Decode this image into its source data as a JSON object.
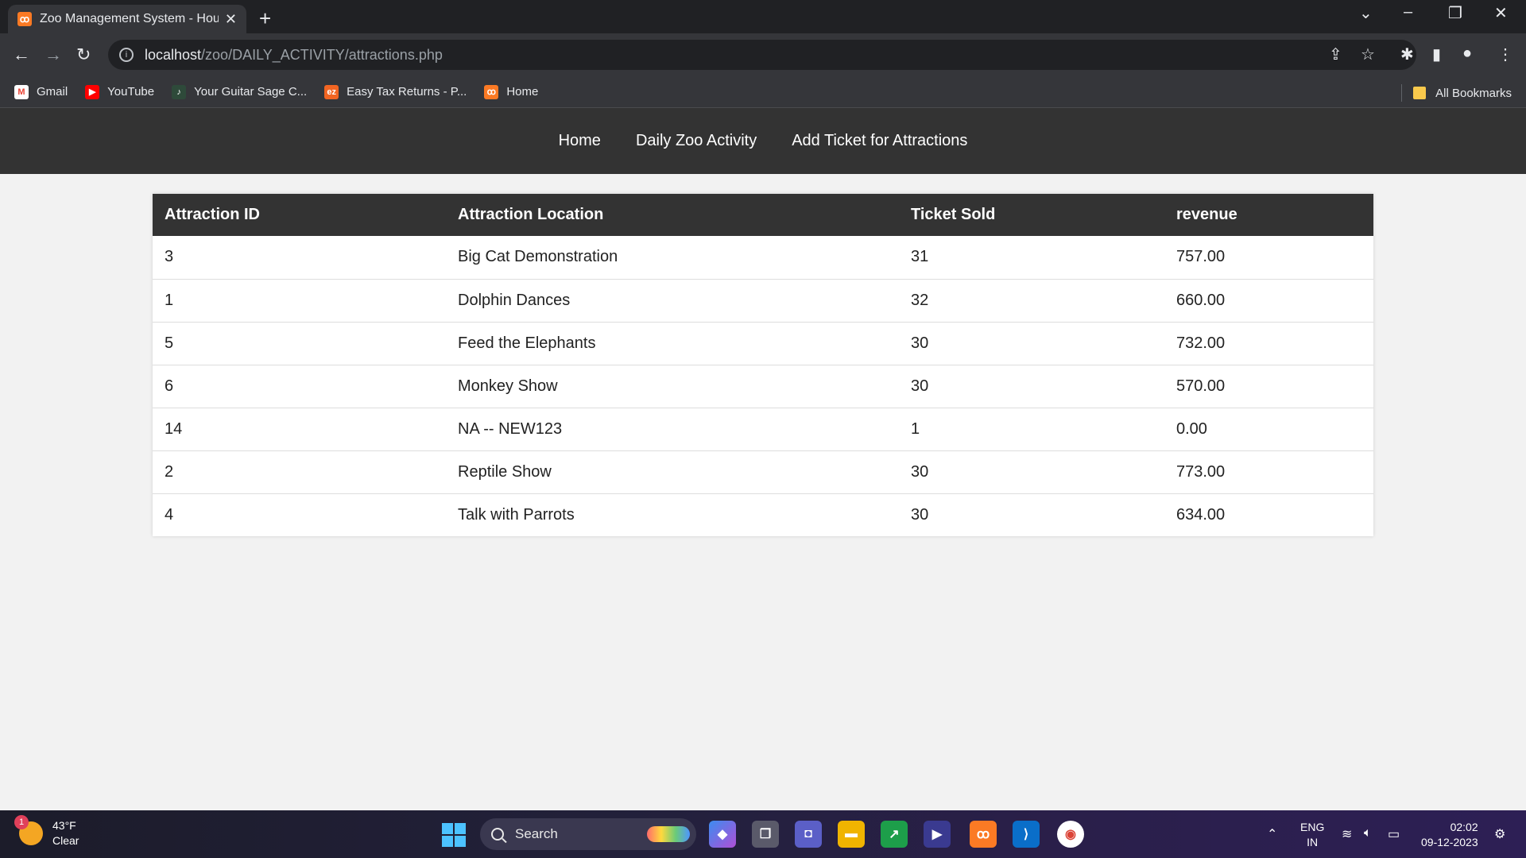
{
  "browser": {
    "tab_title": "Zoo Management System - Hou",
    "url_host": "localhost",
    "url_path": "/zoo/DAILY_ACTIVITY/attractions.php",
    "bookmarks": [
      {
        "label": "Gmail",
        "icon": "gmail-icon"
      },
      {
        "label": "YouTube",
        "icon": "youtube-icon"
      },
      {
        "label": "Your Guitar Sage C...",
        "icon": "guitar-sage-icon"
      },
      {
        "label": "Easy Tax Returns - P...",
        "icon": "ez-icon"
      },
      {
        "label": "Home",
        "icon": "xampp-icon"
      }
    ],
    "all_bookmarks": "All Bookmarks"
  },
  "site_nav": {
    "items": [
      "Home",
      "Daily Zoo Activity",
      "Add Ticket for Attractions"
    ]
  },
  "table": {
    "headers": [
      "Attraction ID",
      "Attraction Location",
      "Ticket Sold",
      "revenue"
    ],
    "rows": [
      [
        "3",
        "Big Cat Demonstration",
        "31",
        "757.00"
      ],
      [
        "1",
        "Dolphin Dances",
        "32",
        "660.00"
      ],
      [
        "5",
        "Feed the Elephants",
        "30",
        "732.00"
      ],
      [
        "6",
        "Monkey Show",
        "30",
        "570.00"
      ],
      [
        "14",
        "NA -- NEW123",
        "1",
        "0.00"
      ],
      [
        "2",
        "Reptile Show",
        "30",
        "773.00"
      ],
      [
        "4",
        "Talk with Parrots",
        "30",
        "634.00"
      ]
    ]
  },
  "taskbar": {
    "weather_temp": "43°F",
    "weather_cond": "Clear",
    "weather_badge": "1",
    "search_label": "Search",
    "lang_top": "ENG",
    "lang_bottom": "IN",
    "time": "02:02",
    "date": "09-12-2023"
  },
  "colors": {
    "nav_bg": "#333333",
    "page_bg": "#f2f2f2",
    "header_bg": "#333333"
  }
}
